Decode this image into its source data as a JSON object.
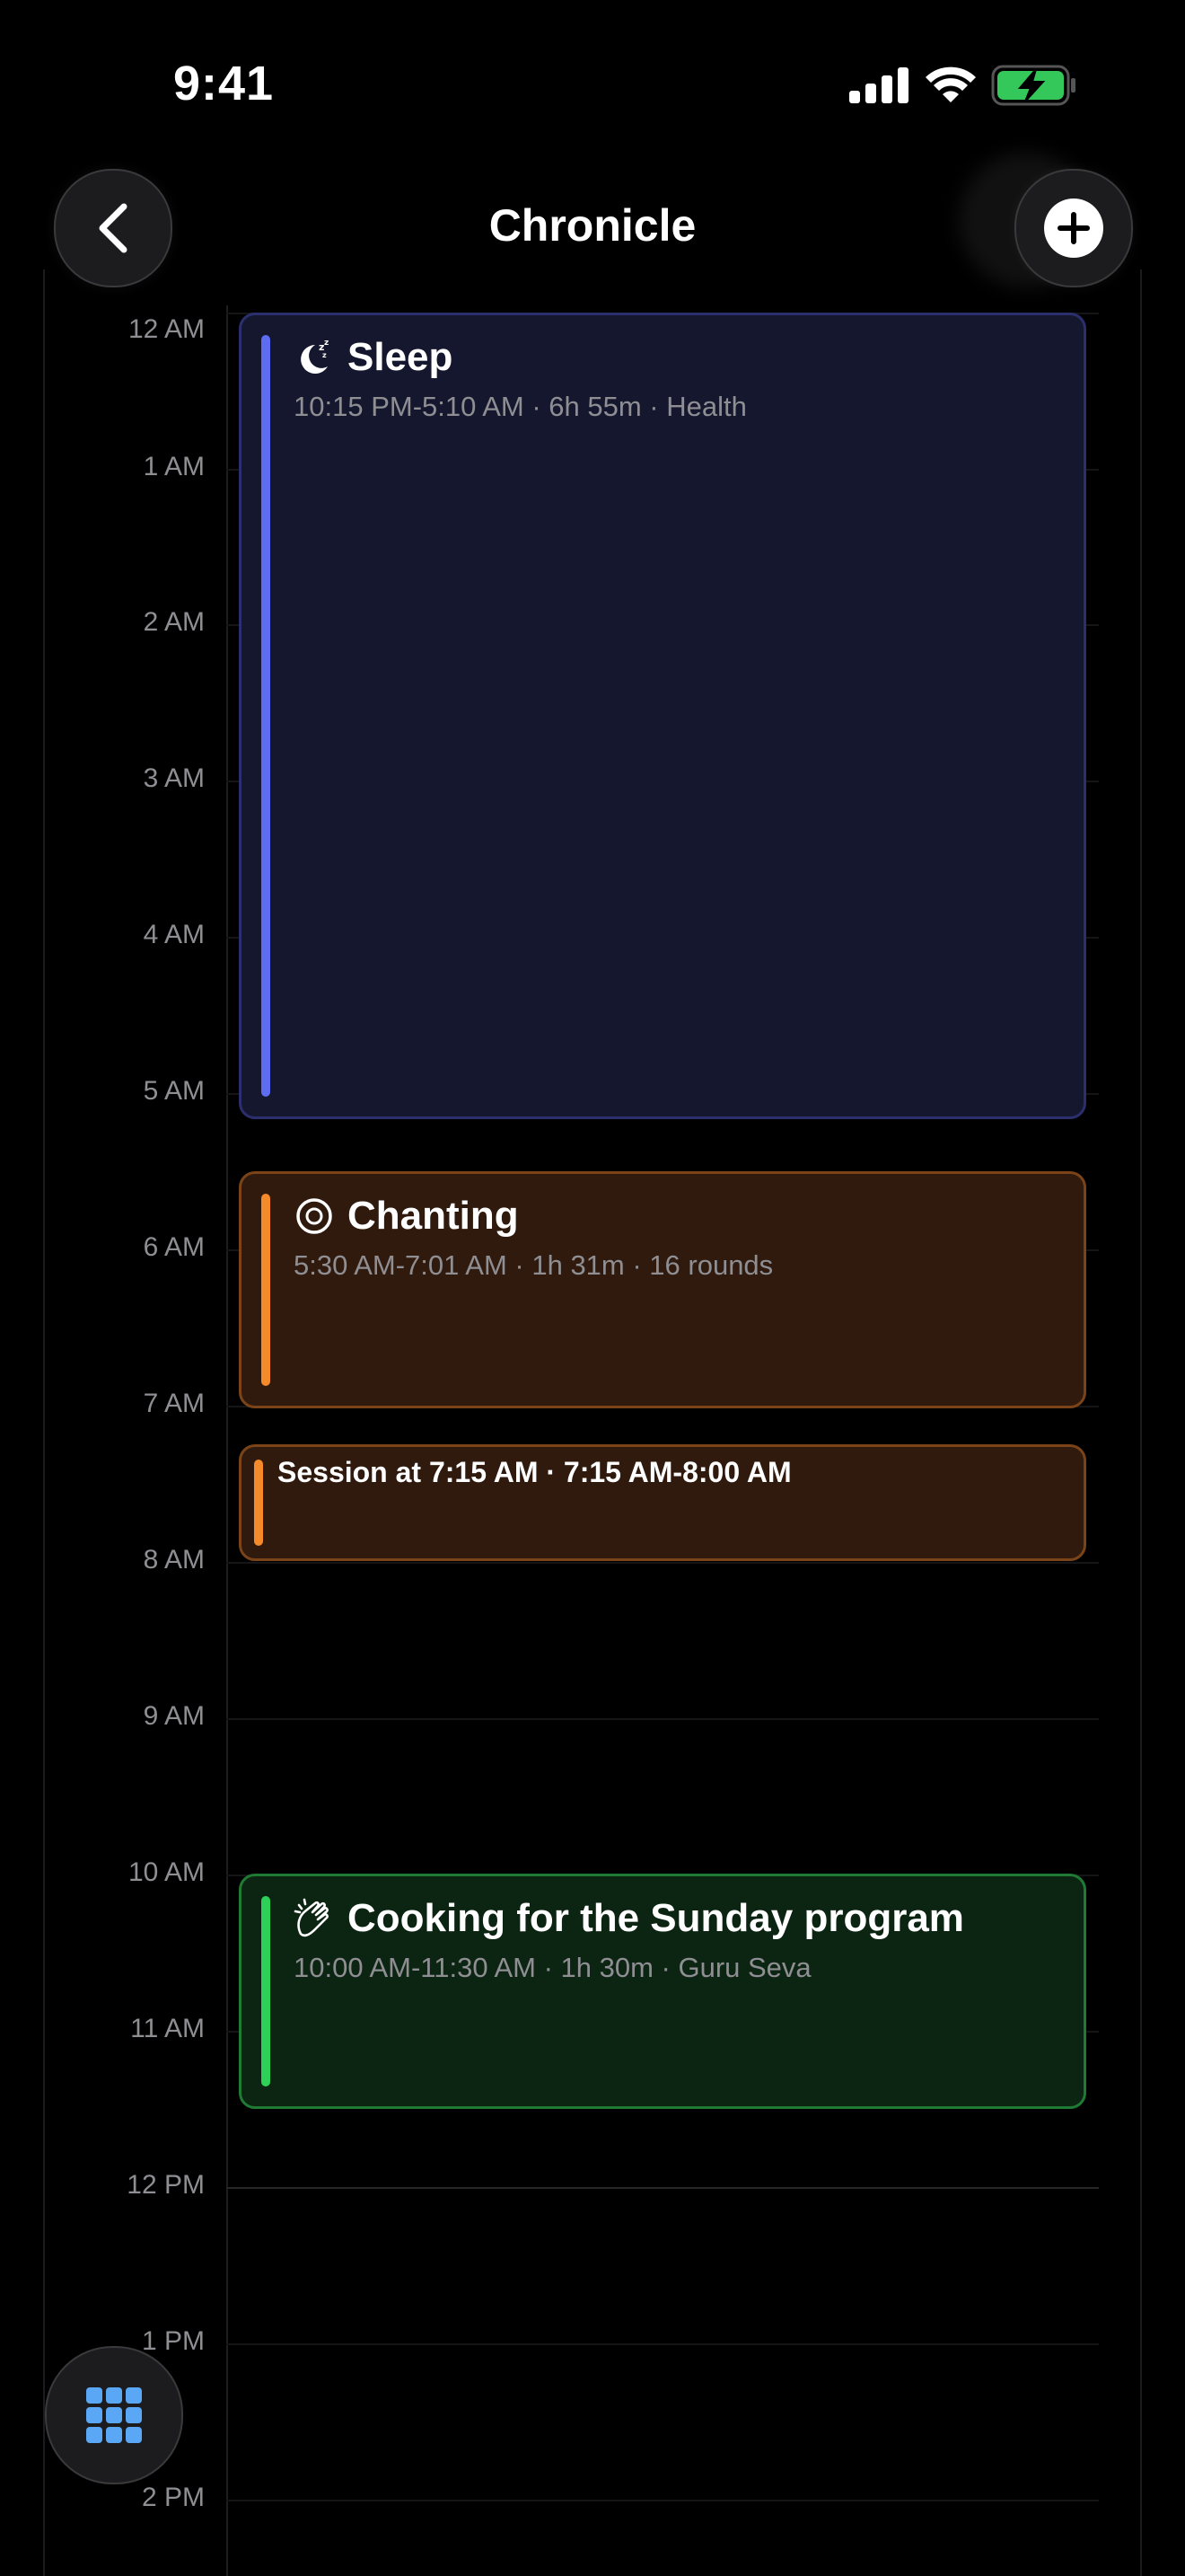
{
  "status_bar": {
    "time": "9:41"
  },
  "header": {
    "title": "Chronicle"
  },
  "timeline": {
    "hours": [
      "12 AM",
      "1 AM",
      "2 AM",
      "3 AM",
      "4 AM",
      "5 AM",
      "6 AM",
      "7 AM",
      "8 AM",
      "9 AM",
      "10 AM",
      "11 AM",
      "12 PM",
      "1 PM",
      "2 PM"
    ]
  },
  "events": {
    "sleep": {
      "title": "Sleep",
      "meta": "10:15 PM-5:10 AM · 6h 55m · Health",
      "icon": "moon-zzz-icon",
      "color": "#5e6cf2"
    },
    "chanting": {
      "title": "Chanting",
      "meta": "5:30 AM-7:01 AM · 1h 31m · 16 rounds",
      "icon": "target-circle-icon",
      "color": "#f58a2a"
    },
    "session": {
      "title": "Session at 7:15 AM · 7:15 AM-8:00 AM",
      "color": "#f58a2a"
    },
    "cooking": {
      "title": "Cooking for the Sunday program",
      "meta": "10:00 AM-11:30 AM · 1h 30m · Guru Seva",
      "icon": "clapping-hands-icon",
      "color": "#2ed158"
    }
  }
}
